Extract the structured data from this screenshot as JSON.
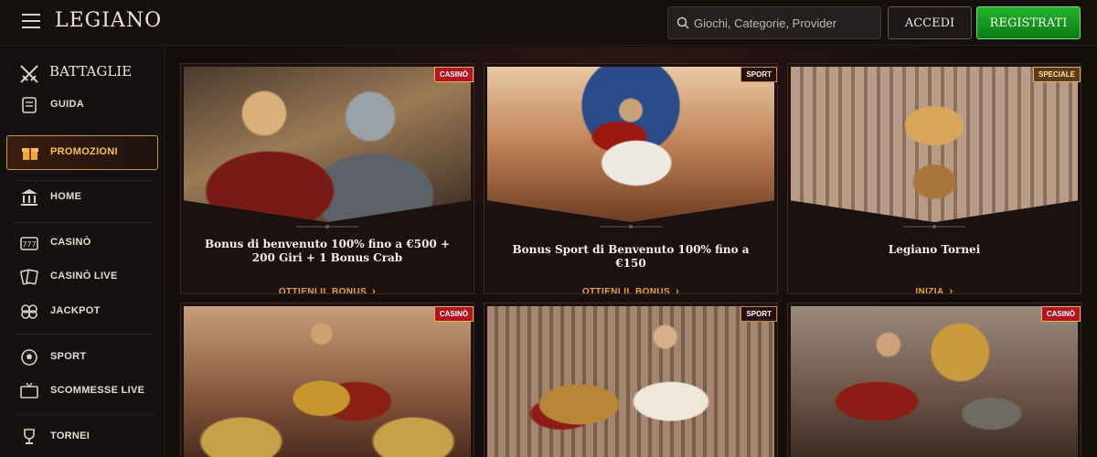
{
  "header": {
    "logo": "LEGIANO",
    "search_placeholder": "Giochi, Categorie, Provider",
    "login_label": "ACCEDI",
    "register_label": "REGISTRATI"
  },
  "sidebar": {
    "heading": "BATTAGLIE",
    "items": [
      {
        "label": "GUIDA",
        "icon": "scroll-icon"
      },
      {
        "label": "PROMOZIONI",
        "icon": "gift-icon"
      },
      {
        "label": "HOME",
        "icon": "temple-icon"
      },
      {
        "label": "CASINÒ",
        "icon": "slot-machine-icon"
      },
      {
        "label": "CASINÒ LIVE",
        "icon": "cards-icon"
      },
      {
        "label": "JACKPOT",
        "icon": "clover-icon"
      },
      {
        "label": "SPORT",
        "icon": "soccer-ball-icon"
      },
      {
        "label": "SCOMMESSE LIVE",
        "icon": "live-tv-icon"
      },
      {
        "label": "TORNEI",
        "icon": "trophy-icon"
      }
    ]
  },
  "cards": [
    {
      "badge": "CASINÒ",
      "title": "Bonus di benvenuto 100% fino a €500 + 200 Giri + 1 Bonus Crab",
      "cta": "OTTIENI IL BONUS"
    },
    {
      "badge": "SPORT",
      "title": "Bonus Sport di Benvenuto 100% fino a €150",
      "cta": "OTTIENI IL BONUS"
    },
    {
      "badge": "SPECIALE",
      "title": "Legiano Tornei",
      "cta": "INIZIA"
    },
    {
      "badge": "CASINÒ",
      "title": "",
      "cta": ""
    },
    {
      "badge": "SPORT",
      "title": "",
      "cta": ""
    },
    {
      "badge": "CASINÒ",
      "title": "",
      "cta": ""
    }
  ],
  "colors": {
    "accent": "#e9a23e",
    "register": "#16a01f",
    "badge_casino": "#b3141d"
  }
}
